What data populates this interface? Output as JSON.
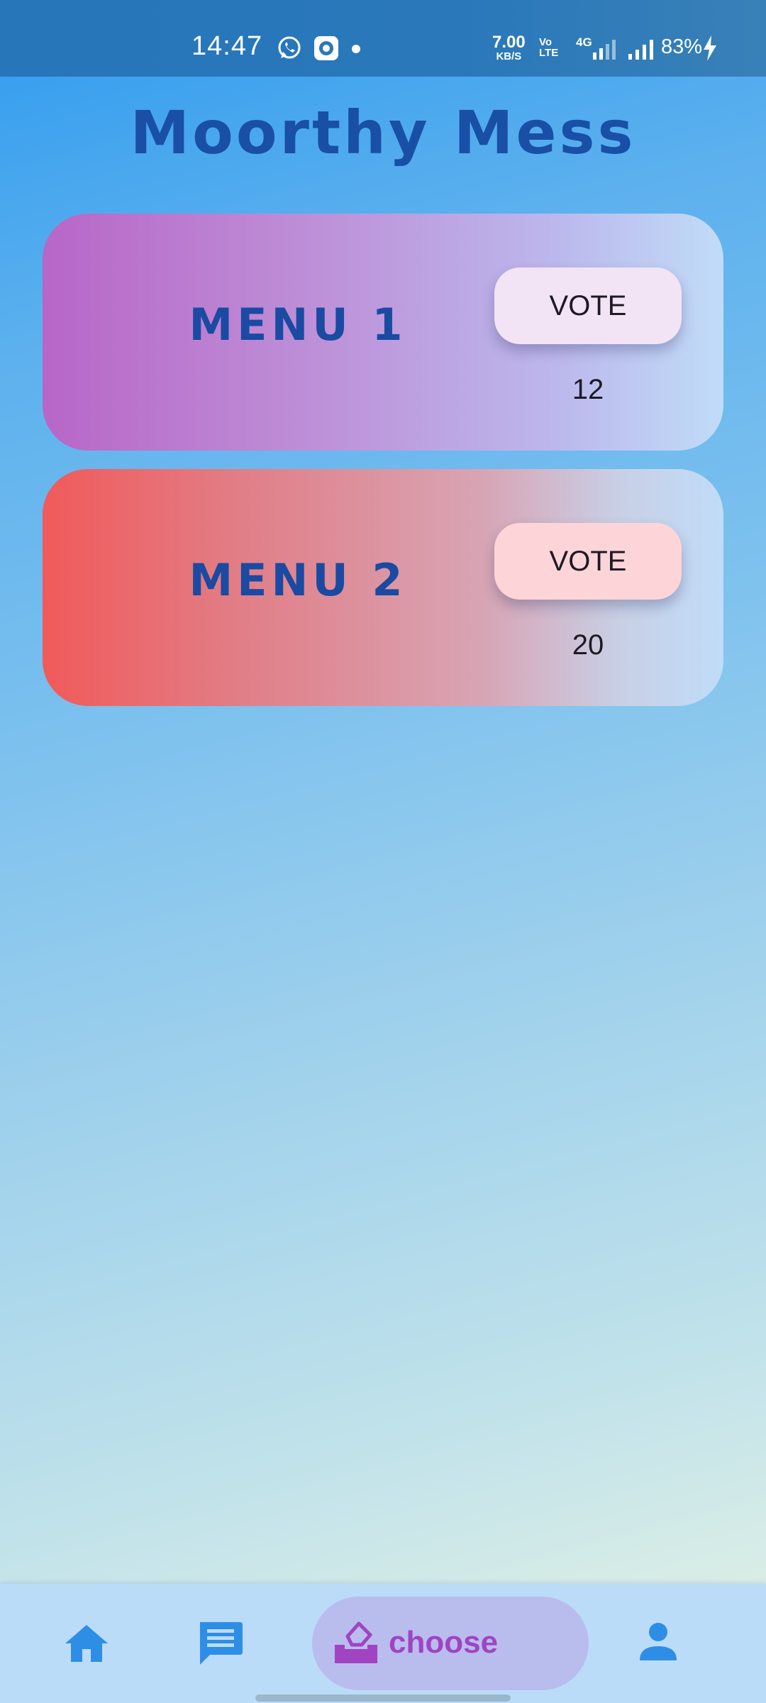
{
  "status_bar": {
    "time": "14:47",
    "network_speed_value": "7.00",
    "network_speed_unit": "KB/S",
    "volte": "Vo LTE",
    "network_type": "4G",
    "battery": "83%",
    "icons": [
      "whatsapp-icon",
      "app-notification-icon",
      "dot-icon",
      "signal-icon",
      "charging-icon"
    ]
  },
  "header": {
    "title": "Moorthy Mess"
  },
  "menus": [
    {
      "label": "MENU 1",
      "vote_label": "VOTE",
      "votes": "12"
    },
    {
      "label": "MENU 2",
      "vote_label": "VOTE",
      "votes": "20"
    }
  ],
  "bottom_nav": {
    "items": [
      {
        "icon": "home-icon"
      },
      {
        "icon": "chat-icon"
      },
      {
        "icon": "ballot-icon",
        "label": "choose",
        "active": true
      },
      {
        "icon": "profile-icon"
      }
    ]
  },
  "colors": {
    "title": "#1a4fa6",
    "active_nav_label": "#a044c2",
    "nav_icon": "#2e8ee6"
  }
}
